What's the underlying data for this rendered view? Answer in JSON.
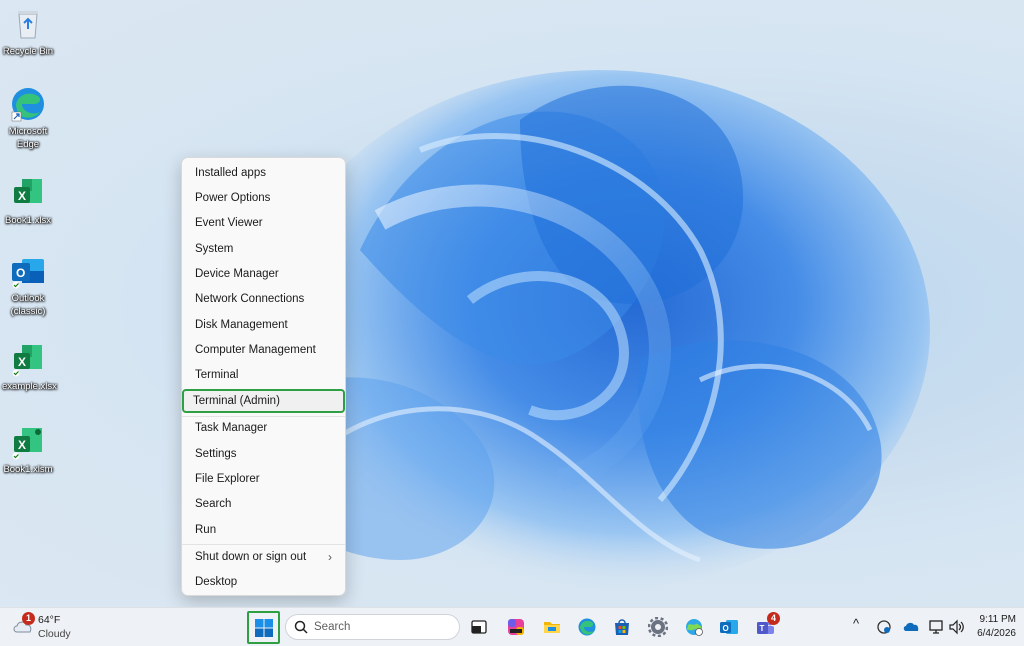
{
  "desktop": {
    "icons": [
      {
        "label": "Recycle Bin",
        "icon": "recycle-bin-icon"
      },
      {
        "label": "Microsoft Edge",
        "icon": "edge-icon"
      },
      {
        "label": "Book1.xlsx",
        "icon": "excel-file-icon"
      },
      {
        "label": "Outlook (classic)",
        "icon": "outlook-icon"
      },
      {
        "label": "example.xlsx",
        "icon": "excel-file-icon"
      },
      {
        "label": "Book1.xlsm",
        "icon": "excel-macro-file-icon"
      }
    ]
  },
  "context_menu": {
    "items": [
      {
        "label": "Installed apps"
      },
      {
        "label": "Power Options"
      },
      {
        "label": "Event Viewer"
      },
      {
        "label": "System"
      },
      {
        "label": "Device Manager"
      },
      {
        "label": "Network Connections"
      },
      {
        "label": "Disk Management"
      },
      {
        "label": "Computer Management"
      },
      {
        "label": "Terminal"
      },
      {
        "label": "Terminal (Admin)",
        "highlighted": true
      },
      {
        "label": "Task Manager"
      },
      {
        "label": "Settings"
      },
      {
        "label": "File Explorer"
      },
      {
        "label": "Search"
      },
      {
        "label": "Run"
      },
      {
        "label": "Shut down or sign out",
        "submenu": true
      },
      {
        "label": "Desktop"
      }
    ],
    "submenu_glyph": "›"
  },
  "taskbar": {
    "weather": {
      "temp": "64°F",
      "condition": "Cloudy",
      "badge": "1"
    },
    "search": {
      "placeholder": "Search"
    },
    "apps": [
      {
        "name": "task-view-icon"
      },
      {
        "name": "copilot-icon"
      },
      {
        "name": "file-explorer-icon"
      },
      {
        "name": "edge-icon"
      },
      {
        "name": "microsoft-store-icon"
      },
      {
        "name": "settings-icon"
      },
      {
        "name": "network-globe-icon"
      },
      {
        "name": "outlook-icon"
      },
      {
        "name": "teams-icon",
        "badge": "4"
      }
    ],
    "tray": {
      "chevron": "^"
    },
    "clock": {
      "time": "9:11 PM",
      "date": "6/4/2026"
    }
  },
  "colors": {
    "highlight": "#2ea043",
    "badge": "#c42b1c",
    "accent": "#0078d4"
  }
}
